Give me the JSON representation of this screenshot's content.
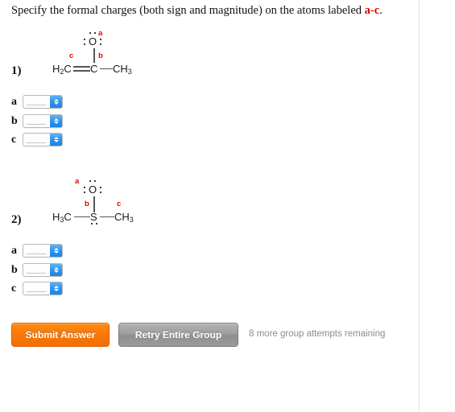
{
  "prompt": {
    "text_before": "Specify the formal charges (both sign and magnitude) on the atoms labeled ",
    "atoms": "a-c",
    "text_after": "."
  },
  "questions": [
    {
      "number": "1)",
      "molecule": {
        "name": "propen-2-olate-like-structure",
        "atoms": [
          {
            "id": "oxygen",
            "text": "O",
            "lone_pairs": [
              "top",
              "left",
              "right"
            ]
          },
          {
            "id": "left-carbon",
            "text": "H2C"
          },
          {
            "id": "center-carbon",
            "text": "C"
          },
          {
            "id": "methyl",
            "text": "CH3"
          }
        ],
        "bonds": [
          {
            "from": "center-carbon",
            "to": "oxygen",
            "order": 1,
            "orientation": "vertical"
          },
          {
            "from": "left-carbon",
            "to": "center-carbon",
            "order": 2,
            "orientation": "horizontal"
          },
          {
            "from": "center-carbon",
            "to": "methyl",
            "order": 1,
            "orientation": "horizontal"
          }
        ],
        "labels": [
          {
            "id": "a",
            "text": "a",
            "on": "oxygen"
          },
          {
            "id": "b",
            "text": "b",
            "on": "center-carbon"
          },
          {
            "id": "c",
            "text": "c",
            "on": "left-carbon"
          }
        ]
      },
      "answers": [
        {
          "label": "a",
          "value": "",
          "placeholder": "______"
        },
        {
          "label": "b",
          "value": "",
          "placeholder": "______"
        },
        {
          "label": "c",
          "value": "",
          "placeholder": "______"
        }
      ]
    },
    {
      "number": "2)",
      "molecule": {
        "name": "dimethyl-sulfoxide",
        "atoms": [
          {
            "id": "oxygen",
            "text": "O",
            "lone_pairs": [
              "top",
              "left",
              "right"
            ]
          },
          {
            "id": "sulfur",
            "text": "S",
            "lone_pairs": [
              "bottom"
            ]
          },
          {
            "id": "left-methyl",
            "text": "H3C"
          },
          {
            "id": "right-methyl",
            "text": "CH3"
          }
        ],
        "bonds": [
          {
            "from": "sulfur",
            "to": "oxygen",
            "order": 1,
            "orientation": "vertical"
          },
          {
            "from": "left-methyl",
            "to": "sulfur",
            "order": 1,
            "orientation": "horizontal"
          },
          {
            "from": "sulfur",
            "to": "right-methyl",
            "order": 1,
            "orientation": "horizontal"
          }
        ],
        "labels": [
          {
            "id": "a",
            "text": "a",
            "on": "oxygen"
          },
          {
            "id": "b",
            "text": "b",
            "on": "sulfur"
          },
          {
            "id": "c",
            "text": "c",
            "on": "right-methyl"
          }
        ]
      },
      "answers": [
        {
          "label": "a",
          "value": "",
          "placeholder": "______"
        },
        {
          "label": "b",
          "value": "",
          "placeholder": "______"
        },
        {
          "label": "c",
          "value": "",
          "placeholder": "______"
        }
      ]
    }
  ],
  "actions": {
    "submit_label": "Submit Answer",
    "retry_label": "Retry Entire Group",
    "attempts_text": "8 more group attempts remaining"
  },
  "colors": {
    "label_red": "#e80000",
    "submit_orange": "#f97808",
    "retry_gray": "#9d9d9d",
    "spinner_blue": "#2e93ee",
    "attempts_gray": "#8c8c8c"
  }
}
